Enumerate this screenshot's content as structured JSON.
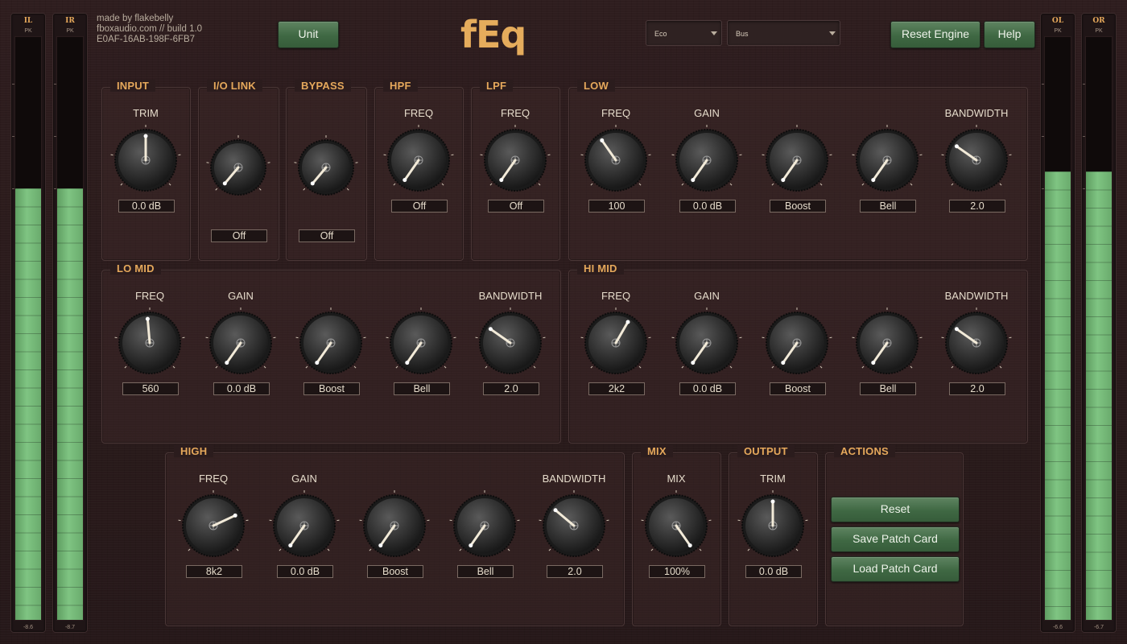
{
  "header": {
    "credit": "made by flakebelly",
    "site": "fboxaudio.com // build 1.0",
    "serial": "E0AF-16AB-198F-6FB7",
    "unit_button": "Unit",
    "logo": "fEq",
    "quality_select": "Eco",
    "mode_select": "Bus",
    "reset_engine_button": "Reset Engine",
    "help_button": "Help"
  },
  "meters": {
    "peak_label": "PK",
    "in_left": {
      "label": "IL",
      "value": "-8.6",
      "level": 0.74
    },
    "in_right": {
      "label": "IR",
      "value": "-8.7",
      "level": 0.74
    },
    "out_left": {
      "label": "OL",
      "value": "-6.6",
      "level": 0.77
    },
    "out_right": {
      "label": "OR",
      "value": "-6.7",
      "level": 0.77
    }
  },
  "sections": {
    "input": {
      "title": "INPUT",
      "trim_label": "TRIM",
      "trim_value": "0.0 dB"
    },
    "io_link": {
      "title": "I/O LINK",
      "value": "Off"
    },
    "bypass": {
      "title": "BYPASS",
      "value": "Off"
    },
    "hpf": {
      "title": "HPF",
      "freq_label": "FREQ",
      "freq_value": "Off"
    },
    "lpf": {
      "title": "LPF",
      "freq_label": "FREQ",
      "freq_value": "Off"
    },
    "low": {
      "title": "LOW",
      "freq_label": "FREQ",
      "gain_label": "GAIN",
      "bw_label": "BANDWIDTH",
      "freq_value": "100",
      "gain_value": "0.0 dB",
      "type_value": "Boost",
      "shape_value": "Bell",
      "bw_value": "2.0"
    },
    "lo_mid": {
      "title": "LO MID",
      "freq_label": "FREQ",
      "gain_label": "GAIN",
      "bw_label": "BANDWIDTH",
      "freq_value": "560",
      "gain_value": "0.0 dB",
      "type_value": "Boost",
      "shape_value": "Bell",
      "bw_value": "2.0"
    },
    "hi_mid": {
      "title": "HI MID",
      "freq_label": "FREQ",
      "gain_label": "GAIN",
      "bw_label": "BANDWIDTH",
      "freq_value": "2k2",
      "gain_value": "0.0 dB",
      "type_value": "Boost",
      "shape_value": "Bell",
      "bw_value": "2.0"
    },
    "high": {
      "title": "HIGH",
      "freq_label": "FREQ",
      "gain_label": "GAIN",
      "bw_label": "BANDWIDTH",
      "freq_value": "8k2",
      "gain_value": "0.0 dB",
      "type_value": "Boost",
      "shape_value": "Bell",
      "bw_value": "2.0"
    },
    "mix": {
      "title": "MIX",
      "mix_label": "MIX",
      "mix_value": "100%"
    },
    "output": {
      "title": "OUTPUT",
      "trim_label": "TRIM",
      "trim_value": "0.0 dB"
    },
    "actions": {
      "title": "ACTIONS",
      "reset": "Reset",
      "save": "Save Patch Card",
      "load": "Load Patch Card"
    }
  },
  "colors": {
    "accent": "#e5a85b",
    "button_green": "#3f6843",
    "meter_green": "#7fc482",
    "background": "#2a1b1c"
  }
}
